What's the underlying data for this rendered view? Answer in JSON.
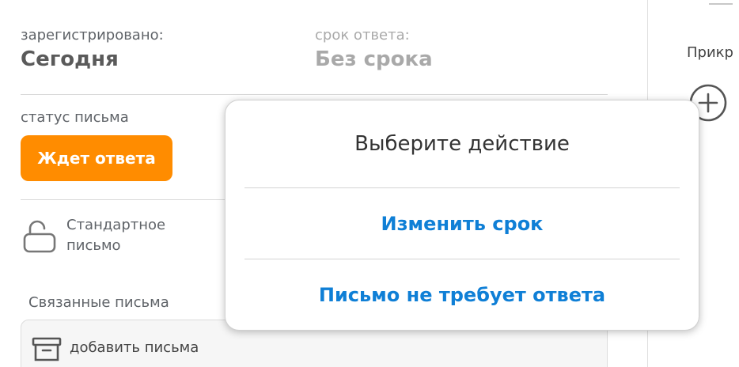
{
  "registered": {
    "label": "зарегистрировано:",
    "value": "Сегодня"
  },
  "deadline": {
    "label": "срок ответа:",
    "value": "Без срока"
  },
  "status": {
    "label": "статус письма",
    "badge": "Ждет ответа",
    "badge_color": "#ff8c00"
  },
  "privacy": {
    "icon": "unlocked-lock-icon",
    "line1": "Стандартное",
    "line2": "письмо"
  },
  "related": {
    "label": "Связанные письма",
    "add_label": "добавить письма",
    "icon": "archive-box-icon"
  },
  "attachments": {
    "label": "Прикр",
    "add_icon": "plus-circle-icon"
  },
  "popup": {
    "title": "Выберите действие",
    "actions": [
      {
        "label": "Изменить срок"
      },
      {
        "label": "Письмо не требует ответа"
      }
    ],
    "action_color": "#0f7fd6"
  }
}
